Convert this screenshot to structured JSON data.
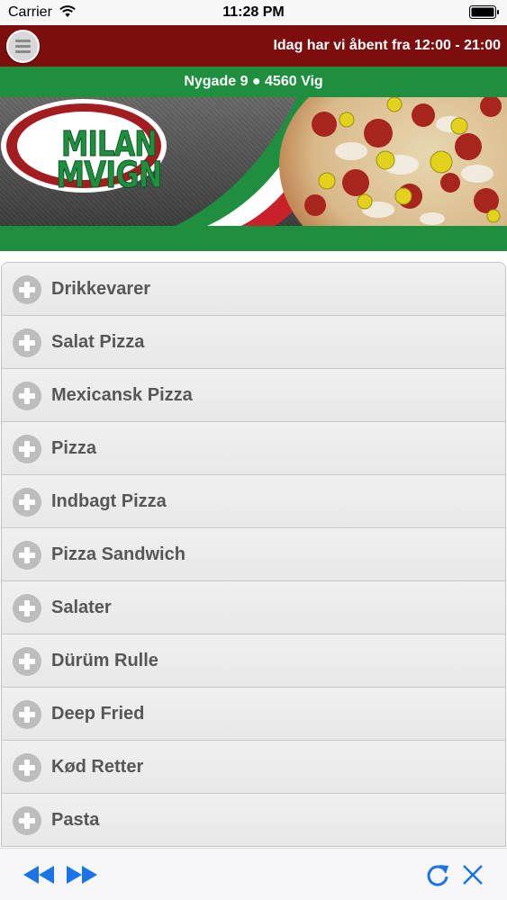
{
  "status_bar": {
    "carrier": "Carrier",
    "time": "11:28 PM"
  },
  "header": {
    "hours": "Idag har vi åbent fra 12:00 - 21:00"
  },
  "address": "Nygade 9 ● 4560 Vig",
  "logo": {
    "line1": "MILAN",
    "line2": "MVIGN"
  },
  "menu": {
    "items": [
      {
        "label": "Drikkevarer"
      },
      {
        "label": "Salat Pizza"
      },
      {
        "label": "Mexicansk Pizza"
      },
      {
        "label": "Pizza"
      },
      {
        "label": "Indbagt Pizza"
      },
      {
        "label": "Pizza Sandwich"
      },
      {
        "label": "Salater"
      },
      {
        "label": "Dürüm Rulle"
      },
      {
        "label": "Deep Fried"
      },
      {
        "label": "Kød Retter"
      },
      {
        "label": "Pasta"
      }
    ]
  },
  "toolbar": {
    "icons": [
      "back-icon",
      "forward-icon",
      "reload-icon",
      "close-icon"
    ]
  },
  "colors": {
    "header_red": "#7d0e0e",
    "brand_green": "#1e8f3e",
    "toolbar_blue": "#1a73e8"
  }
}
